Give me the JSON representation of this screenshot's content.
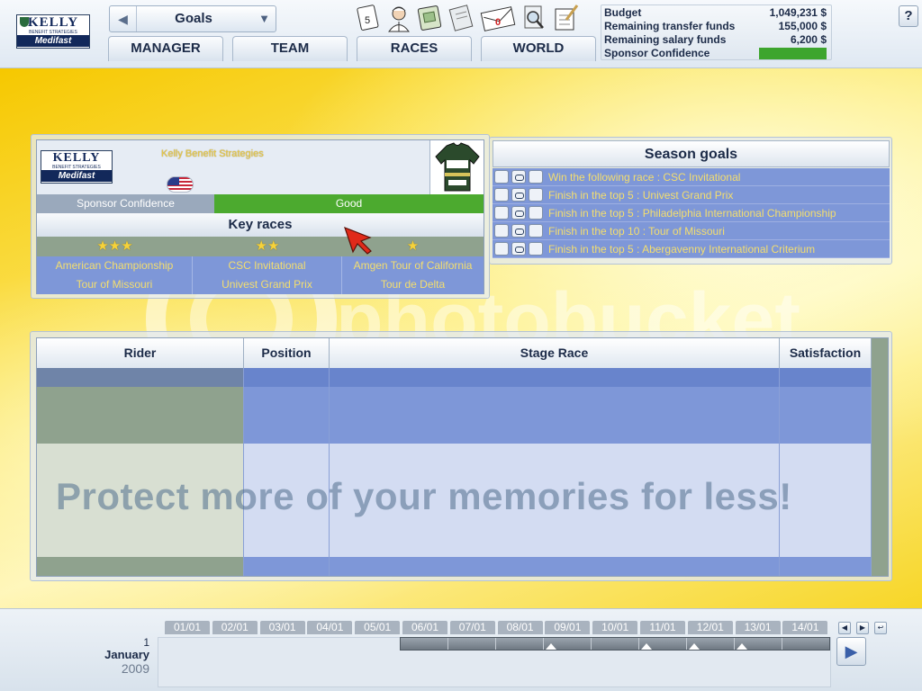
{
  "header": {
    "logo": {
      "brand": "KELLY",
      "tagline": "BENEFIT STRATEGIES",
      "sponsor": "Medifast"
    },
    "page_selector": {
      "value": "Goals",
      "prev_icon": "triangle-left-icon",
      "dropdown_icon": "triangle-down-icon"
    },
    "tabs": [
      "MANAGER",
      "TEAM",
      "RACES",
      "WORLD"
    ],
    "toolbar_icons": [
      {
        "name": "calendar-badge-icon",
        "badge": "5"
      },
      {
        "name": "rider-portrait-icon"
      },
      {
        "name": "finance-book-icon"
      },
      {
        "name": "news-page-icon"
      },
      {
        "name": "mail-icon",
        "badge": "0"
      },
      {
        "name": "search-document-icon"
      },
      {
        "name": "notepad-icon"
      }
    ],
    "budget": {
      "rows": [
        {
          "label": "Budget",
          "value": "1,049,231 $"
        },
        {
          "label": "Remaining transfer funds",
          "value": "155,000 $"
        },
        {
          "label": "Remaining salary funds",
          "value": "6,200 $"
        },
        {
          "label": "Sponsor Confidence",
          "value": ""
        }
      ],
      "confidence_color": "#3da52e"
    },
    "help_label": "?"
  },
  "team": {
    "name": "Kelly Benefit Strategies",
    "logo": {
      "brand": "KELLY",
      "tagline": "BENEFIT STRATEGIES",
      "sponsor": "Medifast"
    },
    "flag": "usa-flag-icon",
    "sponsor_confidence_label": "Sponsor Confidence",
    "sponsor_confidence_value": "Good",
    "key_races_title": "Key races",
    "key_races": [
      {
        "stars": "★★★",
        "race1": "American Championship",
        "race2": "Tour of Missouri"
      },
      {
        "stars": "★★",
        "race1": "CSC Invitational",
        "race2": "Univest Grand Prix"
      },
      {
        "stars": "★",
        "race1": "Amgen Tour of California",
        "race2": "Tour de Delta"
      }
    ]
  },
  "season_goals": {
    "title": "Season goals",
    "items": [
      "Win the following race : CSC Invitational",
      "Finish in the top 5 : Univest Grand Prix",
      "Finish in the top 5 : Philadelphia International Championship",
      "Finish in the top 10 : Tour of Missouri",
      "Finish in the top 5 : Abergavenny International Criterium"
    ]
  },
  "riders_table": {
    "columns": [
      "Rider",
      "Position",
      "Stage Race",
      "Satisfaction"
    ],
    "rows": []
  },
  "calendar": {
    "day": "1",
    "month": "January",
    "year": "2009",
    "days": [
      "01/01",
      "02/01",
      "03/01",
      "04/01",
      "05/01",
      "06/01",
      "07/01",
      "08/01",
      "09/01",
      "10/01",
      "11/01",
      "12/01",
      "13/01",
      "14/01"
    ],
    "next_icon": "arrow-right-icon"
  },
  "watermark": {
    "logo_text": "photobucket",
    "slogan": "Protect more of your memories for less!"
  }
}
